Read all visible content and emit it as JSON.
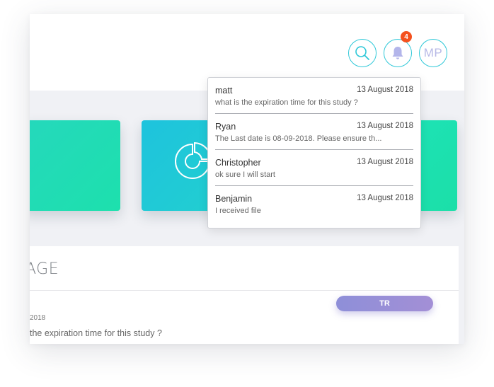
{
  "header": {
    "avatar_initials": "MP",
    "notification_count": "4",
    "accent_color": "#2ec8d8",
    "badge_color": "#f4511e"
  },
  "notifications": [
    {
      "sender": "matt",
      "date": "13 August 2018",
      "preview": "what is the expiration time for this study ?"
    },
    {
      "sender": "Ryan",
      "date": "13 August 2018",
      "preview": "The Last date is 08-09-2018. Please ensure th..."
    },
    {
      "sender": "Christopher",
      "date": "13 August 2018",
      "preview": "ok sure I will start"
    },
    {
      "sender": "Benjamin",
      "date": "13 August 2018",
      "preview": "I received file"
    }
  ],
  "cards": [
    {
      "icon": "none"
    },
    {
      "icon": "pie-chart-icon"
    },
    {
      "icon": "none"
    }
  ],
  "messages_panel": {
    "title": "AGE",
    "date": "2018",
    "message": "the expiration time for this study ?",
    "tag": "TR"
  }
}
